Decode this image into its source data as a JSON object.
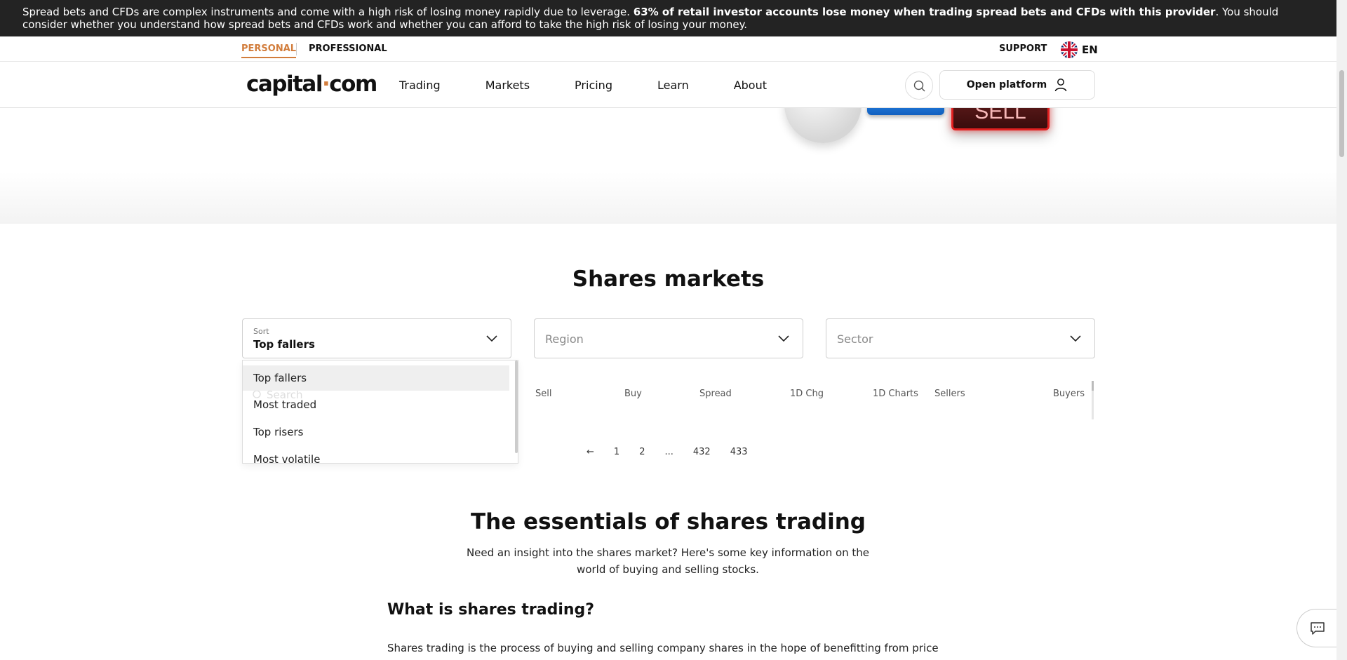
{
  "risk_banner": {
    "text_before": "Spread bets and CFDs are complex instruments and come with a high risk of losing money rapidly due to leverage. ",
    "text_bold": "63% of retail investor accounts lose money when trading spread bets and CFDs with this provider",
    "text_after": ". You should consider whether you understand how spread bets and CFDs work and whether you can afford to take the high risk of losing your money."
  },
  "topbar": {
    "personal": "PERSONAL",
    "professional": "PROFESSIONAL",
    "support": "SUPPORT",
    "language": "EN"
  },
  "nav": {
    "logo_left": "capital",
    "logo_dot": "·",
    "logo_right": "com",
    "items": [
      "Trading",
      "Markets",
      "Pricing",
      "Learn",
      "About"
    ],
    "open_platform": "Open platform"
  },
  "hero": {
    "sell_key": "SELL"
  },
  "shares": {
    "title": "Shares markets",
    "sort": {
      "label": "Sort",
      "value": "Top fallers"
    },
    "region_placeholder": "Region",
    "sector_placeholder": "Sector",
    "search_placeholder": "Search",
    "sort_options": [
      "Top fallers",
      "Most traded",
      "Top risers",
      "Most volatile"
    ],
    "columns": [
      "Sell",
      "Buy",
      "Spread",
      "1D Chg",
      "1D Charts",
      "Sellers",
      "Buyers"
    ],
    "pagination": [
      "←",
      "1",
      "2",
      "...",
      "432",
      "433"
    ]
  },
  "essentials": {
    "title": "The essentials of shares trading",
    "subtitle": "Need an insight into the shares market? Here's some key information on the world of buying and selling stocks.",
    "heading": "What is shares trading?",
    "paragraph": "Shares trading is the process of buying and selling company shares in the hope of benefitting from price"
  },
  "colors": {
    "accent": "#d27d3c",
    "banner": "#232323",
    "sell_red": "#e02020"
  },
  "icons": [
    "search-icon",
    "user-icon",
    "chevron-down-icon",
    "uk-flag-icon",
    "chat-icon",
    "arrow-left-icon"
  ]
}
